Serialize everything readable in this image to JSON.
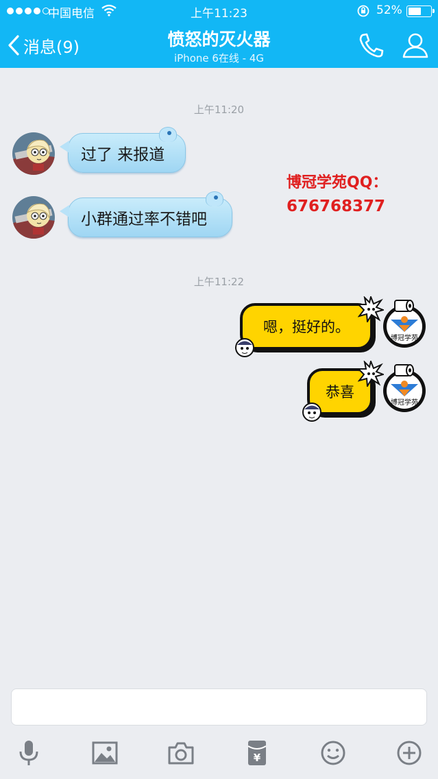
{
  "status_bar": {
    "carrier": "中国电信",
    "time": "上午11:23",
    "battery": "52%",
    "battery_level": 0.52
  },
  "nav": {
    "back_label": "消息(9)",
    "title": "愤怒的灭火器",
    "subtitle": "iPhone 6在线 - 4G"
  },
  "chat": {
    "timestamps": [
      "上午11:20",
      "上午11:22"
    ],
    "incoming": [
      {
        "text": "过了 来报道"
      },
      {
        "text": "小群通过率不错吧"
      }
    ],
    "outgoing": [
      {
        "text": "嗯，挺好的。"
      },
      {
        "text": "恭喜"
      }
    ],
    "my_avatar_text": "博冠学苑"
  },
  "watermark": {
    "line1": "博冠学苑QQ：",
    "line2": "676768377"
  },
  "input": {
    "placeholder": ""
  },
  "colors": {
    "header": "#12b7f5",
    "incoming_bubble": "#a8dcf5",
    "outgoing_bubble": "#ffd400",
    "watermark": "#e02020",
    "icon_gray": "#7a7f86"
  },
  "toolbar_icons": [
    "microphone-icon",
    "image-icon",
    "camera-icon",
    "red-packet-icon",
    "emoji-icon",
    "plus-icon"
  ]
}
